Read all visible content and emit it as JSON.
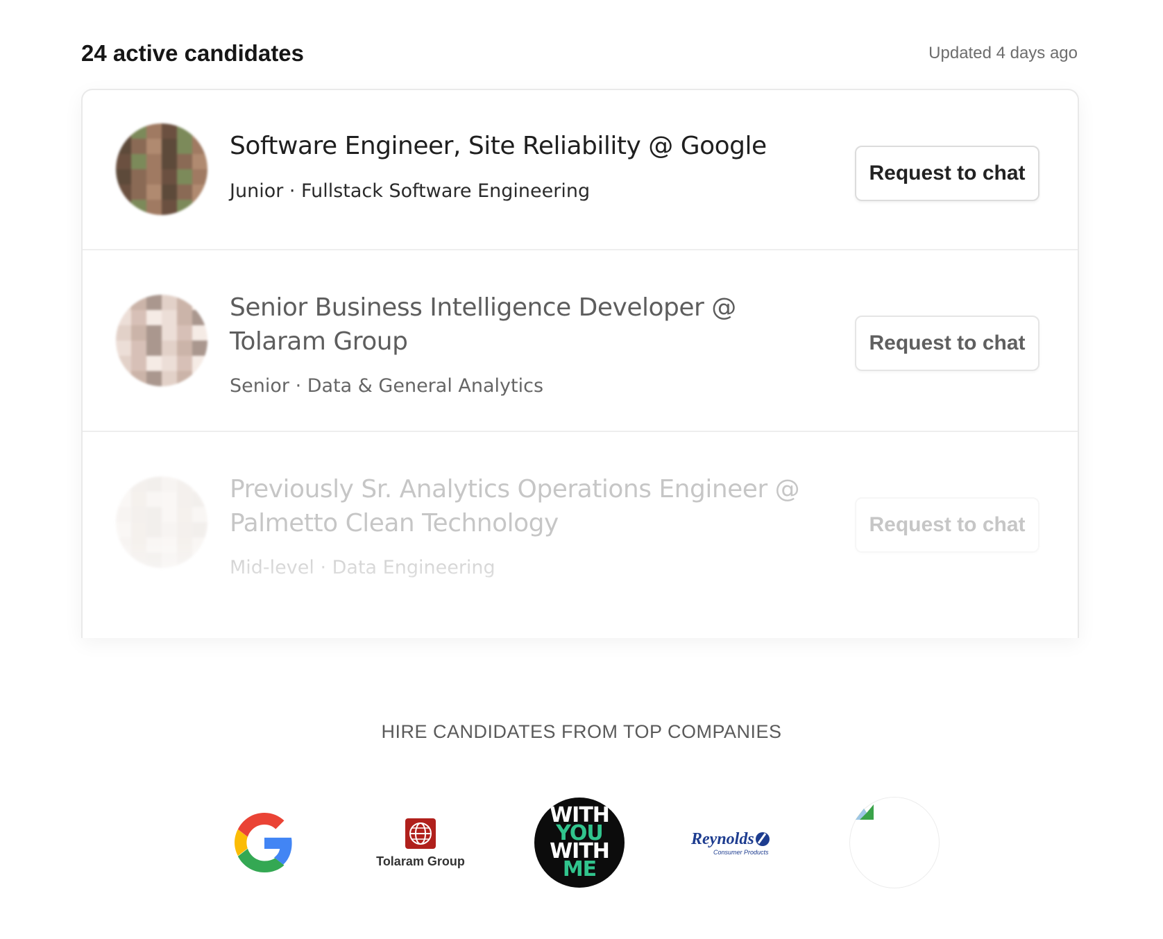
{
  "header": {
    "count_label": "24 active candidates",
    "updated_label": "Updated 4 days ago"
  },
  "candidates": [
    {
      "title": "Software Engineer, Site Reliability @ Google",
      "subtitle": "Junior · Fullstack Software Engineering",
      "button_label": "Request to chat"
    },
    {
      "title": "Senior Business Intelligence Developer @ Tolaram Group",
      "subtitle": "Senior · Data & General Analytics",
      "button_label": "Request to chat"
    },
    {
      "title": "Previously Sr. Analytics Operations Engineer @ Palmetto Clean Technology",
      "subtitle": "Mid-level · Data Engineering",
      "button_label": "Request to chat"
    }
  ],
  "hire_section": {
    "title": "HIRE CANDIDATES FROM TOP COMPANIES",
    "logos": [
      {
        "name": "google-logo"
      },
      {
        "name": "tolaram-group-logo",
        "text": "Tolaram Group"
      },
      {
        "name": "with-you-with-me-logo",
        "lines": [
          "WITH",
          "YOU",
          "WITH",
          "ME"
        ]
      },
      {
        "name": "reynolds-logo",
        "text": "Reynolds",
        "subtext": "Consumer Products"
      },
      {
        "name": "broken-image-logo"
      }
    ]
  },
  "colors": {
    "brand_green": "#31c48d",
    "google_blue": "#4285F4",
    "google_red": "#EA4335",
    "google_yellow": "#FBBC05",
    "google_green": "#34A853",
    "reynolds_blue": "#1d3c8f"
  }
}
